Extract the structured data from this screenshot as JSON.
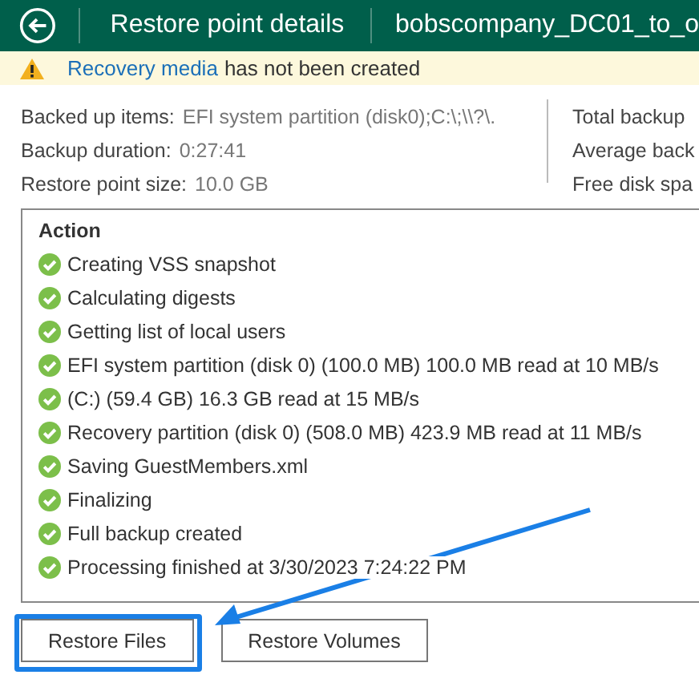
{
  "header": {
    "title": "Restore point details",
    "backup_name": "bobscompany_DC01_to_o"
  },
  "warning": {
    "link": "Recovery media",
    "text": "has not been created"
  },
  "details_left": [
    {
      "label": "Backed up items:",
      "value": "EFI system partition (disk0);C:\\;\\\\?\\."
    },
    {
      "label": "Backup duration:",
      "value": "0:27:41"
    },
    {
      "label": "Restore point size:",
      "value": "10.0 GB"
    }
  ],
  "details_right": [
    "Total backup",
    "Average back",
    "Free disk spa"
  ],
  "action_log": {
    "heading": "Action",
    "items": [
      {
        "kind": "success",
        "text": "Creating VSS snapshot"
      },
      {
        "kind": "success",
        "text": "Calculating digests"
      },
      {
        "kind": "success",
        "text": "Getting list of local users"
      },
      {
        "kind": "success",
        "text": "EFI system partition (disk 0) (100.0 MB) 100.0 MB read at 10 MB/s"
      },
      {
        "kind": "success",
        "text": "(C:) (59.4 GB) 16.3 GB read at 15 MB/s"
      },
      {
        "kind": "success",
        "text": "Recovery partition (disk 0) (508.0 MB) 423.9 MB read at 11 MB/s"
      },
      {
        "kind": "success",
        "text": "Saving GuestMembers.xml"
      },
      {
        "kind": "success",
        "text": "Finalizing"
      },
      {
        "kind": "success",
        "text": "Full backup created"
      },
      {
        "kind": "success",
        "text": "Processing finished at 3/30/2023 7:24:22 PM"
      }
    ]
  },
  "buttons": [
    {
      "label": "Restore Files",
      "highlighted": true
    },
    {
      "label": "Restore Volumes",
      "highlighted": false
    }
  ]
}
